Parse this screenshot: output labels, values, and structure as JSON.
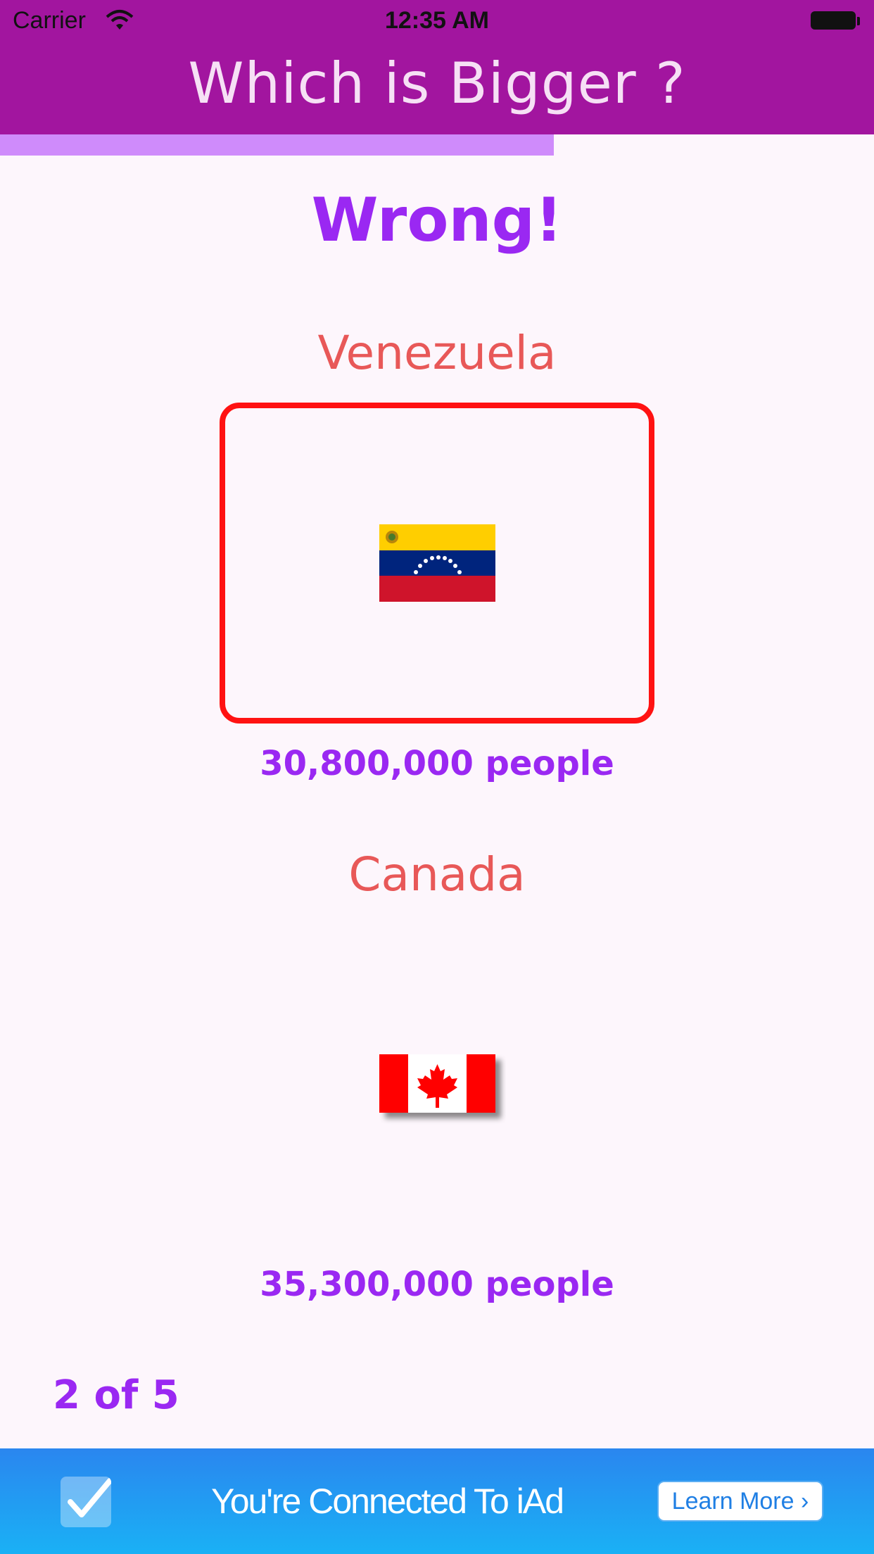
{
  "status_bar": {
    "carrier": "Carrier",
    "time": "12:35 AM"
  },
  "header": {
    "title": "Which is Bigger ?",
    "color": "#a2159f"
  },
  "quiz": {
    "progress_fraction": 0.634,
    "result": "Wrong!",
    "question_counter": "2 of 5"
  },
  "countries": [
    {
      "name": "Venezuela",
      "population": "30,800,000 people",
      "flag": "venezuela-flag",
      "selected": true
    },
    {
      "name": "Canada",
      "population": "35,300,000 people",
      "flag": "canada-flag",
      "selected": false
    }
  ],
  "ad_banner": {
    "text": "You're Connected To iAd",
    "button_label": "Learn More",
    "button_chevron": "›"
  },
  "colors": {
    "accent_purple": "#9a28f2",
    "country_red": "#e85858",
    "selection_red": "#ff1212",
    "progress": "#cf8bfb"
  }
}
